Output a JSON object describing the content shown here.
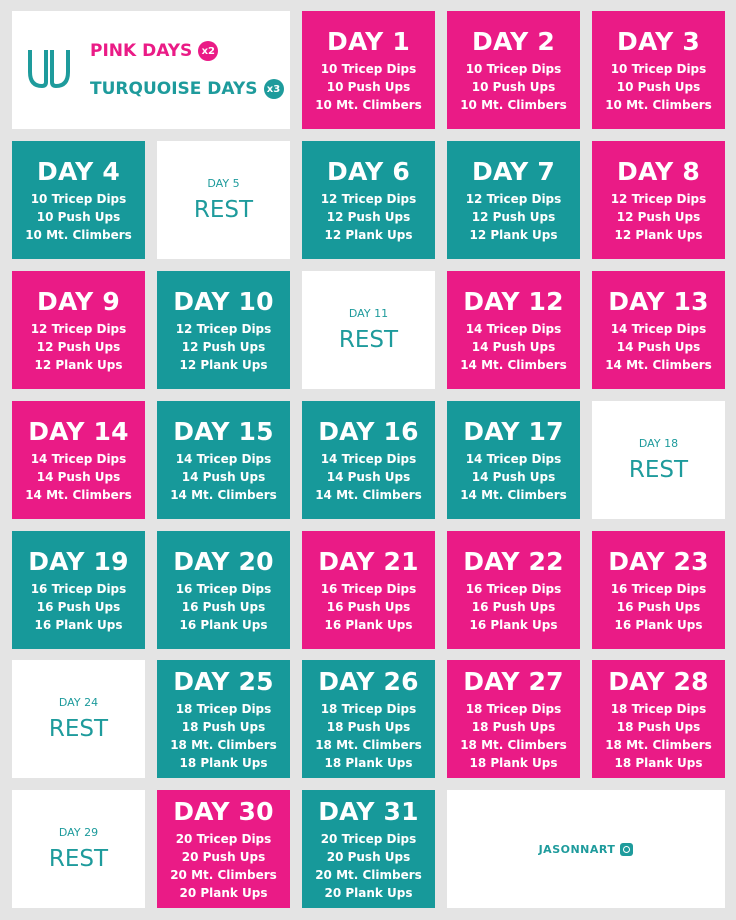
{
  "legend": {
    "pink_label": "PINK DAYS",
    "pink_badge": "x2",
    "teal_label": "TURQUOISE DAYS",
    "teal_badge": "x3"
  },
  "colors": {
    "pink": "#ea1b86",
    "teal": "#17999a",
    "white": "#ffffff"
  },
  "credit": "JASONNART",
  "credit_icon": "instagram-icon",
  "days": [
    {
      "label": "DAY 1",
      "color": "pink",
      "items": [
        "10 Tricep Dips",
        "10 Push Ups",
        "10 Mt. Climbers"
      ]
    },
    {
      "label": "DAY 2",
      "color": "pink",
      "items": [
        "10 Tricep Dips",
        "10 Push Ups",
        "10 Mt. Climbers"
      ]
    },
    {
      "label": "DAY 3",
      "color": "pink",
      "items": [
        "10 Tricep Dips",
        "10 Push Ups",
        "10 Mt. Climbers"
      ]
    },
    {
      "label": "DAY 4",
      "color": "teal",
      "items": [
        "10 Tricep Dips",
        "10 Push Ups",
        "10 Mt. Climbers"
      ]
    },
    {
      "label": "DAY 5",
      "color": "rest",
      "rest": "REST"
    },
    {
      "label": "DAY 6",
      "color": "teal",
      "items": [
        "12 Tricep Dips",
        "12 Push Ups",
        "12 Plank Ups"
      ]
    },
    {
      "label": "DAY 7",
      "color": "teal",
      "items": [
        "12 Tricep Dips",
        "12 Push Ups",
        "12 Plank Ups"
      ]
    },
    {
      "label": "DAY 8",
      "color": "pink",
      "items": [
        "12 Tricep Dips",
        "12 Push Ups",
        "12 Plank Ups"
      ]
    },
    {
      "label": "DAY 9",
      "color": "pink",
      "items": [
        "12 Tricep Dips",
        "12 Push Ups",
        "12 Plank Ups"
      ]
    },
    {
      "label": "DAY 10",
      "color": "teal",
      "items": [
        "12 Tricep Dips",
        "12 Push Ups",
        "12 Plank Ups"
      ]
    },
    {
      "label": "DAY 11",
      "color": "rest",
      "rest": "REST"
    },
    {
      "label": "DAY 12",
      "color": "pink",
      "items": [
        "14 Tricep Dips",
        "14 Push Ups",
        "14 Mt. Climbers"
      ]
    },
    {
      "label": "DAY 13",
      "color": "pink",
      "items": [
        "14 Tricep Dips",
        "14 Push Ups",
        "14 Mt. Climbers"
      ]
    },
    {
      "label": "DAY 14",
      "color": "pink",
      "items": [
        "14 Tricep Dips",
        "14 Push Ups",
        "14 Mt. Climbers"
      ]
    },
    {
      "label": "DAY 15",
      "color": "teal",
      "items": [
        "14 Tricep Dips",
        "14 Push Ups",
        "14 Mt. Climbers"
      ]
    },
    {
      "label": "DAY 16",
      "color": "teal",
      "items": [
        "14 Tricep Dips",
        "14 Push Ups",
        "14 Mt. Climbers"
      ]
    },
    {
      "label": "DAY 17",
      "color": "teal",
      "items": [
        "14 Tricep Dips",
        "14 Push Ups",
        "14 Mt. Climbers"
      ]
    },
    {
      "label": "DAY 18",
      "color": "rest",
      "rest": "REST"
    },
    {
      "label": "DAY 19",
      "color": "teal",
      "items": [
        "16 Tricep Dips",
        "16 Push Ups",
        "16 Plank Ups"
      ]
    },
    {
      "label": "DAY 20",
      "color": "teal",
      "items": [
        "16 Tricep Dips",
        "16 Push Ups",
        "16 Plank Ups"
      ]
    },
    {
      "label": "DAY 21",
      "color": "pink",
      "items": [
        "16 Tricep Dips",
        "16 Push Ups",
        "16 Plank Ups"
      ]
    },
    {
      "label": "DAY 22",
      "color": "pink",
      "items": [
        "16 Tricep Dips",
        "16 Push Ups",
        "16 Plank Ups"
      ]
    },
    {
      "label": "DAY 23",
      "color": "pink",
      "items": [
        "16 Tricep Dips",
        "16 Push Ups",
        "16 Plank Ups"
      ]
    },
    {
      "label": "DAY 24",
      "color": "rest",
      "rest": "REST"
    },
    {
      "label": "DAY 25",
      "color": "teal",
      "items": [
        "18 Tricep Dips",
        "18 Push Ups",
        "18 Mt. Climbers",
        "18 Plank Ups"
      ]
    },
    {
      "label": "DAY 26",
      "color": "teal",
      "items": [
        "18 Tricep Dips",
        "18 Push Ups",
        "18 Mt. Climbers",
        "18 Plank Ups"
      ]
    },
    {
      "label": "DAY 27",
      "color": "pink",
      "items": [
        "18 Tricep Dips",
        "18 Push Ups",
        "18 Mt. Climbers",
        "18 Plank Ups"
      ]
    },
    {
      "label": "DAY 28",
      "color": "pink",
      "items": [
        "18 Tricep Dips",
        "18 Push Ups",
        "18 Mt. Climbers",
        "18 Plank Ups"
      ]
    },
    {
      "label": "DAY 29",
      "color": "rest",
      "rest": "REST"
    },
    {
      "label": "DAY 30",
      "color": "pink",
      "items": [
        "20 Tricep Dips",
        "20 Push Ups",
        "20 Mt. Climbers",
        "20 Plank Ups"
      ]
    },
    {
      "label": "DAY 31",
      "color": "teal",
      "items": [
        "20 Tricep Dips",
        "20 Push Ups",
        "20 Mt. Climbers",
        "20 Plank Ups"
      ]
    }
  ]
}
